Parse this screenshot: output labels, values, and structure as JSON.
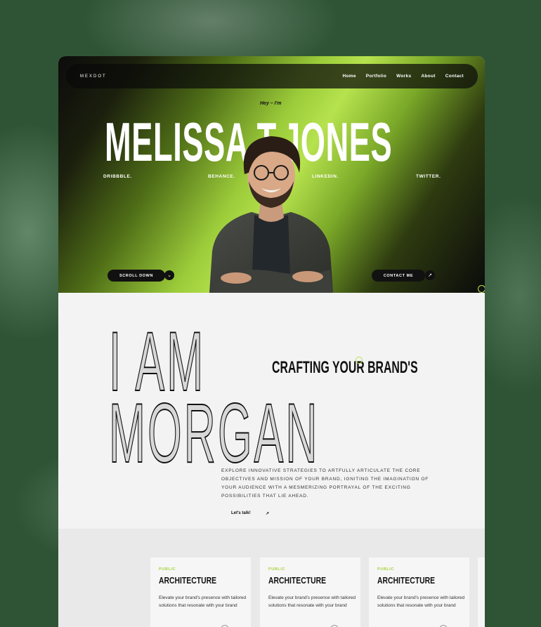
{
  "nav": {
    "logo": "MEXDOT",
    "links": [
      "Home",
      "Portfolio",
      "Works",
      "About",
      "Contact"
    ]
  },
  "hero": {
    "greeting": "Hey – I'm",
    "name": "MELISSA T.JONES",
    "socials": [
      "DRIBBBLE.",
      "BEHANCE.",
      "LINKEDIN.",
      "TWITTER."
    ],
    "scroll_label": "SCROLL DOWN",
    "scroll_icon": "arrow-down-icon",
    "contact_label": "CONTACT ME",
    "contact_icon": "arrow-up-right-icon"
  },
  "about": {
    "big_line1": "I AM",
    "big_line2": "MORGAN",
    "tagline": "CRAFTING YOUR BRAND'S",
    "description": "Explore innovative strategies to artfully articulate the core objectives and mission of your brand, igniting the imagination of your audience with a mesmerizing portrayal of the exciting possibilities that lie ahead.",
    "cta_label": "Let's talk!",
    "cta_icon": "arrow-up-right-icon"
  },
  "services": {
    "cards": [
      {
        "tag": "PUBLIC",
        "title": "ARCHITECTURE",
        "text": "Elevate your brand's presence with tailored solutions that resonate with your brand"
      },
      {
        "tag": "PUBLIC",
        "title": "ARCHITECTURE",
        "text": "Elevate your brand's presence with tailored solutions that resonate with your brand"
      },
      {
        "tag": "PUBLIC",
        "title": "ARCHITECTURE",
        "text": "Elevate your brand's presence with tailored solutions that resonate with your brand"
      }
    ]
  },
  "colors": {
    "accent": "#b6e24e",
    "background": "#2f5435",
    "dark": "#111111"
  }
}
